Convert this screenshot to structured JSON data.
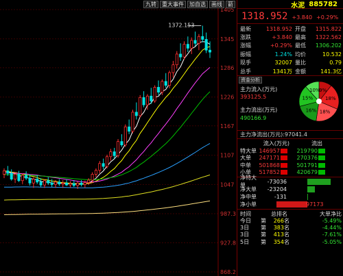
{
  "toolbar": [
    "九转",
    "重大事件",
    "加自选",
    "画线",
    "箭"
  ],
  "stock": {
    "name": "水泥",
    "code": "885782"
  },
  "quote": {
    "price": "1318.952",
    "change": "+3.840",
    "change_pct": "+0.29%"
  },
  "stats": [
    {
      "k": "最新",
      "v": "1318.952",
      "vc": "red",
      "k2": "开盘",
      "v2": "1315.822",
      "v2c": "red"
    },
    {
      "k": "涨跌",
      "v": "+3.840",
      "vc": "red",
      "k2": "最高",
      "v2": "1322.562",
      "v2c": "red"
    },
    {
      "k": "涨幅",
      "v": "+0.29%",
      "vc": "red",
      "k2": "最低",
      "v2": "1306.202",
      "v2c": "green"
    },
    {
      "k": "振幅",
      "v": "1.24%",
      "vc": "cyan",
      "k2": "均价",
      "v2": "10.532",
      "v2c": "yellow"
    },
    {
      "k": "现手",
      "v": "32007",
      "vc": "yellow",
      "k2": "量比",
      "v2": "0.79",
      "v2c": "yellow"
    },
    {
      "k": "总手",
      "v": "1341万",
      "vc": "yellow",
      "k2": "金额",
      "v2": "141.3亿",
      "v2c": "yellow"
    }
  ],
  "funds": {
    "tab": "资金分析",
    "inflow_label": "主力流入(万元)",
    "inflow_value": "393125.5",
    "outflow_label": "主力流出(万元)",
    "outflow_value": "490166.9",
    "pie": [
      "9%",
      "18%",
      "18%",
      "16%",
      "15%",
      "10%"
    ],
    "pie_colors": [
      "#c41010",
      "#e82020",
      "#ff5050",
      "#1a9a1a",
      "#22c422",
      "#55e055"
    ]
  },
  "net_flow": "主力净流出(万元):97041.4",
  "flow_table": {
    "head": [
      "流入(万元)",
      "流出"
    ],
    "rows": [
      {
        "label": "特大单",
        "in": "146957",
        "out": "219790"
      },
      {
        "label": "大单",
        "in": "247171",
        "out": "270376"
      },
      {
        "label": "中单",
        "in": "501868",
        "out": "501791"
      },
      {
        "label": "小单",
        "in": "517852",
        "out": "420679"
      }
    ]
  },
  "net_bars": [
    {
      "label": "净特大单",
      "value": "-73036",
      "ratio": -0.75
    },
    {
      "label": "净大单",
      "value": "-23204",
      "ratio": -0.24
    },
    {
      "label": "净中单",
      "value": "-131",
      "ratio": -0.01
    },
    {
      "label": "净小单",
      "value": "97173",
      "ratio": 1.0
    }
  ],
  "rank": {
    "head": [
      "时间",
      "总排名",
      "大单净比"
    ],
    "rows": [
      {
        "t": "今日",
        "n": "266",
        "p": "-5.49%"
      },
      {
        "t": "3日",
        "n": "383",
        "p": "-4.44%"
      },
      {
        "t": "3日",
        "n": "413",
        "p": "-7.61%"
      },
      {
        "t": "5日",
        "n": "354",
        "p": "-5.05%"
      }
    ],
    "word_pre": "第",
    "word_post": "名"
  },
  "chart_data": {
    "type": "candlestick",
    "y_ticks": [
      "1405",
      "1345",
      "1286",
      "1226",
      "1167",
      "1107",
      "1047",
      "987.3",
      "927.8",
      "868.2"
    ],
    "ylim": [
      868.2,
      1405
    ],
    "annotation": "1372.153",
    "candles": [
      [
        1068,
        1080,
        1060,
        1075
      ],
      [
        1075,
        1085,
        1065,
        1070
      ],
      [
        1070,
        1078,
        1055,
        1058
      ],
      [
        1058,
        1072,
        1050,
        1068
      ],
      [
        1068,
        1075,
        1052,
        1055
      ],
      [
        1055,
        1070,
        1048,
        1066
      ],
      [
        1066,
        1074,
        1056,
        1060
      ],
      [
        1060,
        1068,
        1045,
        1050
      ],
      [
        1050,
        1062,
        1040,
        1058
      ],
      [
        1058,
        1066,
        1048,
        1052
      ],
      [
        1052,
        1060,
        1042,
        1046
      ],
      [
        1046,
        1058,
        1040,
        1055
      ],
      [
        1055,
        1062,
        1046,
        1050
      ],
      [
        1050,
        1058,
        1042,
        1047
      ],
      [
        1047,
        1056,
        1040,
        1052
      ],
      [
        1052,
        1058,
        1044,
        1048
      ],
      [
        1048,
        1056,
        1040,
        1050
      ],
      [
        1050,
        1058,
        1044,
        1046
      ],
      [
        1046,
        1054,
        1040,
        1049
      ],
      [
        1049,
        1056,
        1042,
        1045
      ],
      [
        1045,
        1053,
        1038,
        1050
      ],
      [
        1050,
        1056,
        1043,
        1047
      ],
      [
        1047,
        1055,
        1040,
        1051
      ],
      [
        1051,
        1060,
        1046,
        1056
      ],
      [
        1056,
        1072,
        1050,
        1068
      ],
      [
        1068,
        1080,
        1062,
        1076
      ],
      [
        1076,
        1095,
        1070,
        1090
      ],
      [
        1090,
        1100,
        1078,
        1084
      ],
      [
        1084,
        1108,
        1080,
        1104
      ],
      [
        1104,
        1120,
        1096,
        1114
      ],
      [
        1114,
        1122,
        1100,
        1106
      ],
      [
        1106,
        1140,
        1102,
        1135
      ],
      [
        1135,
        1150,
        1124,
        1128
      ],
      [
        1128,
        1170,
        1124,
        1165
      ],
      [
        1165,
        1180,
        1150,
        1156
      ],
      [
        1156,
        1200,
        1152,
        1195
      ],
      [
        1195,
        1215,
        1180,
        1188
      ],
      [
        1188,
        1230,
        1184,
        1225
      ],
      [
        1225,
        1238,
        1205,
        1210
      ],
      [
        1210,
        1232,
        1200,
        1228
      ],
      [
        1228,
        1245,
        1212,
        1218
      ],
      [
        1218,
        1250,
        1214,
        1246
      ],
      [
        1246,
        1260,
        1230,
        1236
      ],
      [
        1236,
        1262,
        1230,
        1258
      ],
      [
        1258,
        1275,
        1245,
        1250
      ],
      [
        1250,
        1280,
        1244,
        1276
      ],
      [
        1276,
        1300,
        1266,
        1292
      ],
      [
        1292,
        1320,
        1284,
        1314
      ],
      [
        1314,
        1336,
        1300,
        1308
      ],
      [
        1308,
        1340,
        1302,
        1334
      ],
      [
        1334,
        1350,
        1318,
        1326
      ],
      [
        1326,
        1348,
        1314,
        1342
      ],
      [
        1342,
        1360,
        1330,
        1336
      ],
      [
        1336,
        1355,
        1322,
        1350
      ],
      [
        1350,
        1372,
        1338,
        1344
      ],
      [
        1344,
        1358,
        1316,
        1322
      ],
      [
        1322,
        1340,
        1306,
        1318
      ]
    ],
    "ma_colors": [
      "#ffffff",
      "#ffff00",
      "#ff40ff",
      "#00c000",
      "#2aa0ff",
      "#e0e020",
      "#ffe080"
    ]
  }
}
